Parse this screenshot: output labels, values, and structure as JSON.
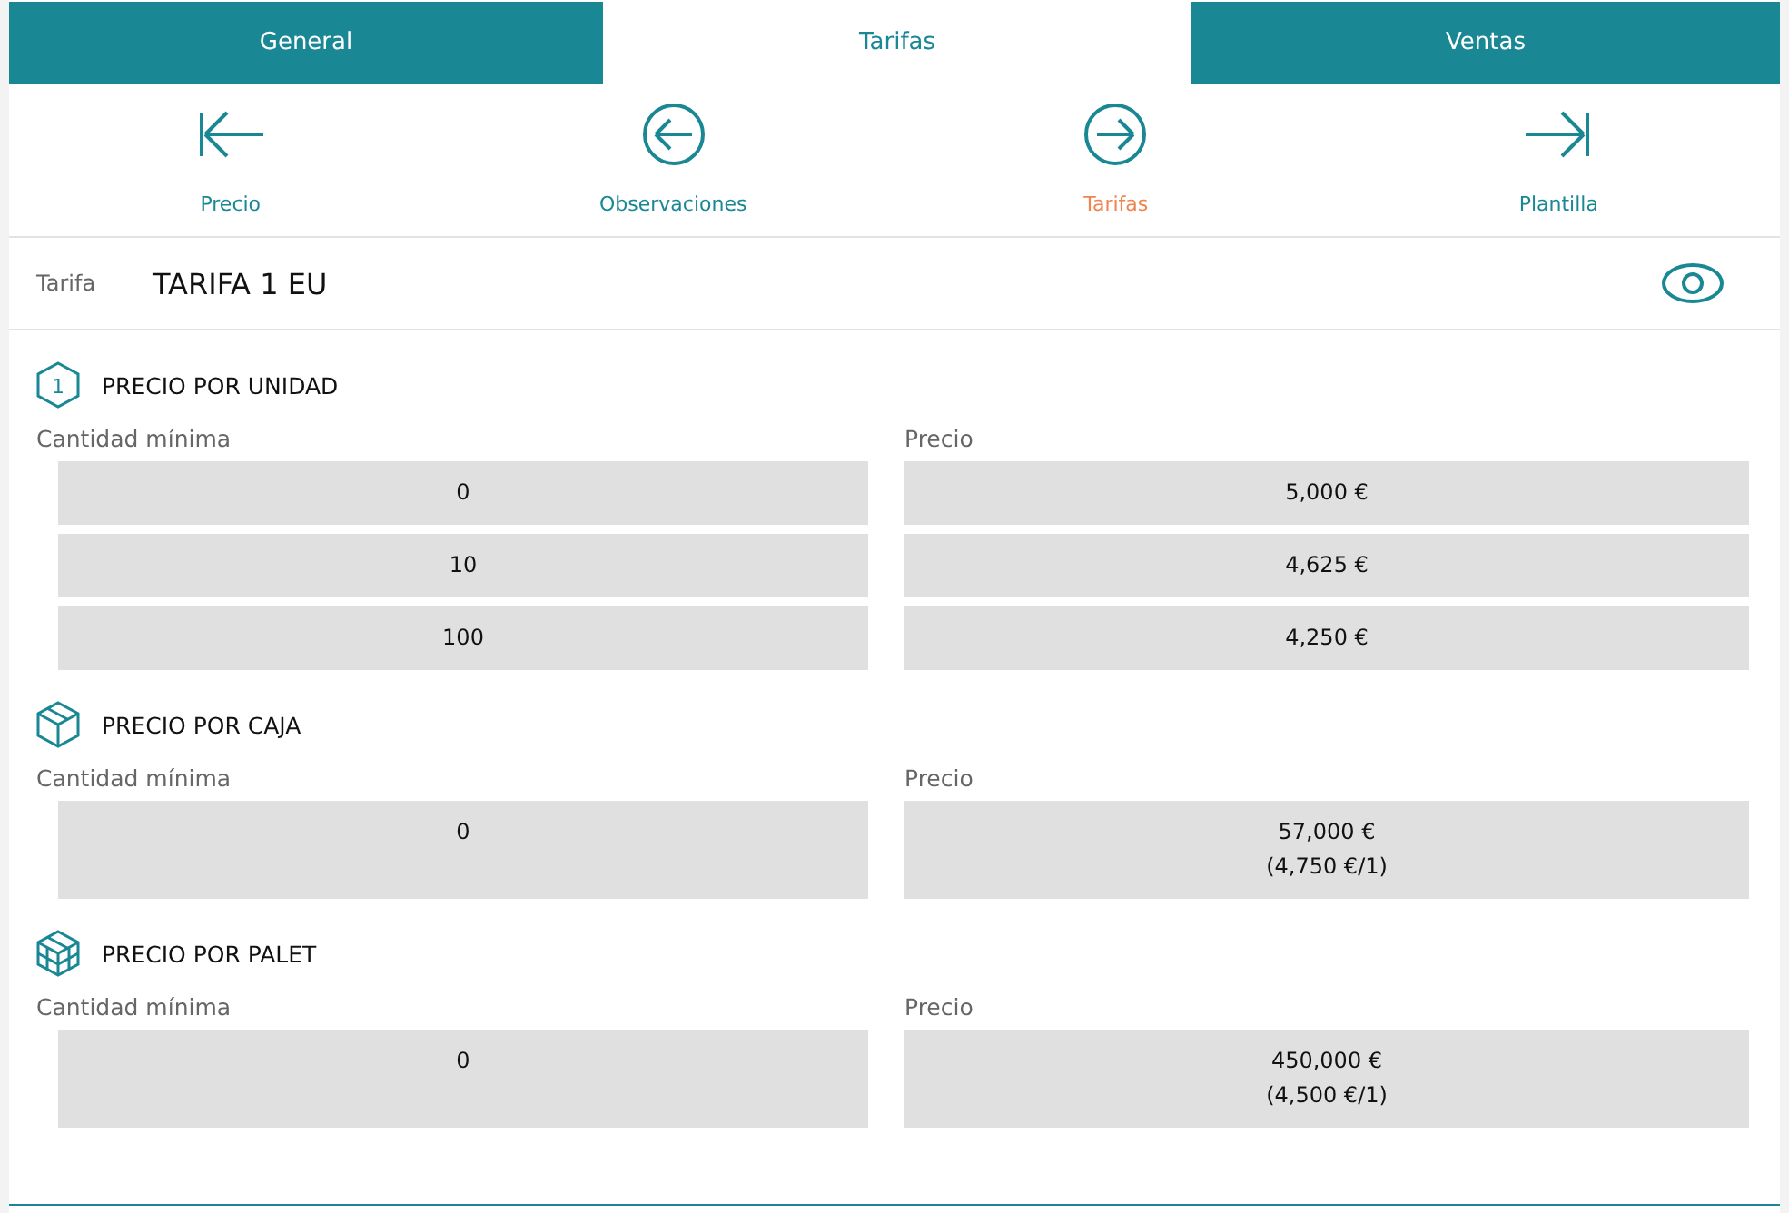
{
  "tabs": [
    {
      "label": "General",
      "selected": false
    },
    {
      "label": "Tarifas",
      "selected": true
    },
    {
      "label": "Ventas",
      "selected": false
    }
  ],
  "nav": [
    {
      "kind": "first",
      "label": "Precio",
      "selected": false
    },
    {
      "kind": "prev",
      "label": "Observaciones",
      "selected": false
    },
    {
      "kind": "next",
      "label": "Tarifas",
      "selected": true
    },
    {
      "kind": "last",
      "label": "Plantilla",
      "selected": false
    }
  ],
  "tarifa": {
    "label": "Tarifa",
    "value": "TARIFA 1 EU"
  },
  "sections": [
    {
      "kind": "unit",
      "icon_text": "1",
      "title": "PRECIO POR UNIDAD",
      "col_1": "Cantidad mínima",
      "col_2": "Precio",
      "rows": [
        {
          "quantity": "0",
          "price": [
            "5,000 €"
          ]
        },
        {
          "quantity": "10",
          "price": [
            "4,625 €"
          ]
        },
        {
          "quantity": "100",
          "price": [
            "4,250 €"
          ]
        }
      ]
    },
    {
      "kind": "box",
      "title": "PRECIO POR CAJA",
      "col_1": "Cantidad mínima",
      "col_2": "Precio",
      "rows": [
        {
          "quantity": "0",
          "price": [
            "57,000 €",
            "(4,750 €/1)"
          ]
        }
      ]
    },
    {
      "kind": "pallet",
      "title": "PRECIO POR PALET",
      "col_1": "Cantidad mínima",
      "col_2": "Precio",
      "rows": [
        {
          "quantity": "0",
          "price": [
            "450,000 €",
            "(4,500 €/1)"
          ]
        }
      ]
    }
  ]
}
